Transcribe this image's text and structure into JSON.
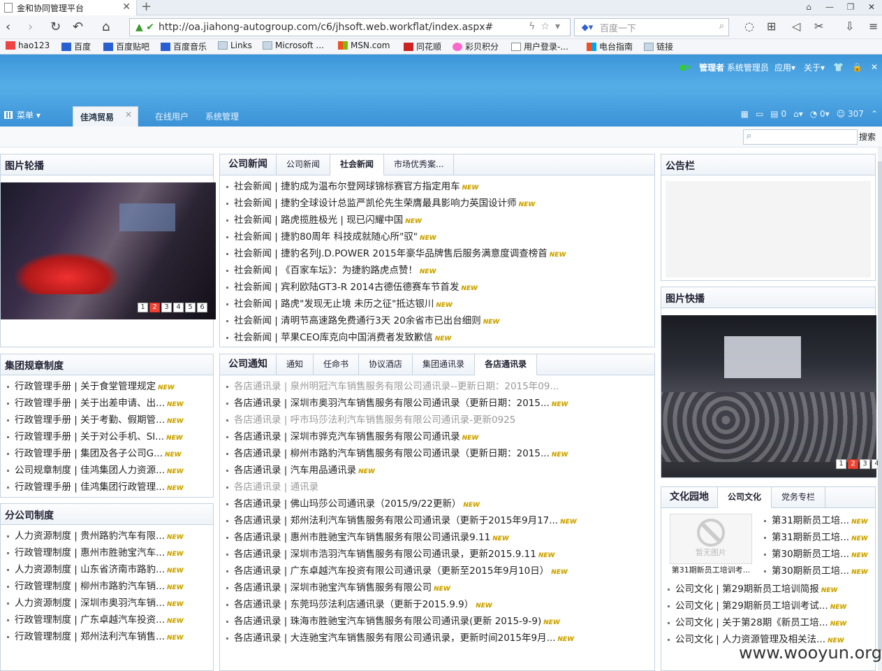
{
  "browser": {
    "tab_title": "金和协同管理平台",
    "url": "http://oa.jiahong-autogroup.com/c6/jhsoft.web.workflat/index.aspx#",
    "search_placeholder": "百度一下",
    "bookmarks": [
      "hao123",
      "百度",
      "百度贴吧",
      "百度音乐",
      "Links",
      "Microsoft ...",
      "MSN.com",
      "同花顺",
      "彩贝积分",
      "用户登录-...",
      "电台指南",
      "链接"
    ]
  },
  "header": {
    "admin_label": "管理者",
    "admin_name": "系统管理员",
    "app_menu": "应用",
    "about_menu": "关于",
    "menu_label": "菜单",
    "active_tab": "佳鸿贸易",
    "tab_online": "在线用户",
    "tab_sys": "系统管理",
    "count_msgs": "0",
    "count_chat": "0",
    "count_users": "307",
    "search_btn": "搜索"
  },
  "badge_new": "NEW",
  "slideshow": {
    "title": "图片轮播",
    "pages": [
      "1",
      "2",
      "3",
      "4",
      "5",
      "6"
    ]
  },
  "news": {
    "title": "公司新闻",
    "tabs": [
      "公司新闻",
      "社会新闻",
      "市场优秀案..."
    ],
    "items": [
      "社会新闻 | 捷豹成为温布尔登网球锦标赛官方指定用车",
      "社会新闻 | 捷豹全球设计总监严凯伦先生荣膺最具影响力英国设计师",
      "社会新闻 | 路虎揽胜极光 | 现已闪耀中国",
      "社会新闻 | 捷豹80周年 科技成就随心所\"驭\"",
      "社会新闻 | 捷豹名列J.D.POWER 2015年豪华品牌售后服务满意度调查榜首",
      "社会新闻 | 《百家车坛》：为捷豹路虎点赞！",
      "社会新闻 | 宾利欧陆GT3-R 2014古德伍德赛车节首发",
      "社会新闻 | 路虎\"发现无止境 未历之征\"抵达银川",
      "社会新闻 | 清明节高速路免费通行3天 20余省市已出台细则",
      "社会新闻 | 苹果CEO库克向中国消费者发致歉信"
    ]
  },
  "notice": {
    "title": "公告栏"
  },
  "quickpics": {
    "title": "图片快播",
    "pages": [
      "1",
      "2",
      "3",
      "4"
    ]
  },
  "rules": {
    "title": "集团规章制度",
    "items": [
      "行政管理手册 | 关于食堂管理规定",
      "行政管理手册 | 关于出差申请、出...",
      "行政管理手册 | 关于考勤、假期管...",
      "行政管理手册 | 关于对公手机、SI...",
      "行政管理手册 | 集团及各子公司G...",
      "公司规章制度 | 佳鸿集团人力资源...",
      "行政管理手册 | 佳鸿集团行政管理..."
    ]
  },
  "branch": {
    "title": "分公司制度",
    "items": [
      "人力资源制度 | 贵州路豹汽车有限...",
      "行政管理制度 | 惠州市胜驰宝汽车...",
      "人力资源制度 | 山东省济南市路豹...",
      "行政管理制度 | 柳州市路豹汽车销...",
      "人力资源制度 | 深圳市奥羽汽车销...",
      "行政管理制度 | 广东卓越汽车投资...",
      "行政管理制度 | 郑州法利汽车销售..."
    ]
  },
  "cnotice": {
    "title": "公司通知",
    "tabs": [
      "通知",
      "任命书",
      "协议酒店",
      "集团通讯录",
      "各店通讯录"
    ],
    "items": [
      {
        "t": "各店通讯录 | 泉州明冠汽车销售服务有限公司通讯录--更新日期：2015年09...",
        "g": true,
        "n": false
      },
      {
        "t": "各店通讯录 | 深圳市奥羽汽车销售服务有限公司通讯录（更新日期：2015...",
        "g": false,
        "n": true
      },
      {
        "t": "各店通讯录 | 呼市玛莎法利汽车销售服务有限公司通讯录-更新0925",
        "g": true,
        "n": false
      },
      {
        "t": "各店通讯录 | 深圳市骅克汽车销售服务有限公司通讯录",
        "g": false,
        "n": true
      },
      {
        "t": "各店通讯录 | 柳州市路豹汽车销售服务有限公司通讯录（更新日期：2015...",
        "g": false,
        "n": true
      },
      {
        "t": "各店通讯录 | 汽车用品通讯录",
        "g": false,
        "n": true
      },
      {
        "t": "各店通讯录 | 通讯录",
        "g": true,
        "n": false
      },
      {
        "t": "各店通讯录 | 佛山玛莎公司通讯录（2015/9/22更新）",
        "g": false,
        "n": true
      },
      {
        "t": "各店通讯录 | 郑州法利汽车销售服务有限公司通讯录（更新于2015年9月17...",
        "g": false,
        "n": true
      },
      {
        "t": "各店通讯录 | 惠州市胜驰宝汽车销售服务有限公司通讯录9.11",
        "g": false,
        "n": true
      },
      {
        "t": "各店通讯录 | 深圳市浩羽汽车销售服务有限公司通讯录，更新2015.9.11",
        "g": false,
        "n": true
      },
      {
        "t": "各店通讯录 | 广东卓越汽车投资有限公司通讯录（更新至2015年9月10日）",
        "g": false,
        "n": true
      },
      {
        "t": "各店通讯录 | 深圳市驰宝汽车销售服务有限公司",
        "g": false,
        "n": true
      },
      {
        "t": "各店通讯录 | 东莞玛莎法利店通讯录（更新于2015.9.9）",
        "g": false,
        "n": true
      },
      {
        "t": "各店通讯录 | 珠海市胜驰宝汽车销售服务有限公司通讯录(更新 2015-9-9)",
        "g": false,
        "n": true
      },
      {
        "t": "各店通讯录 | 大连驰宝汽车销售服务有限公司通讯录，更新时间2015年9月...",
        "g": false,
        "n": true
      }
    ]
  },
  "culture": {
    "title": "文化园地",
    "tabs": [
      "公司文化",
      "党务专栏"
    ],
    "no_pic": "暂无图片",
    "pic_caption": "第31期新员工培训考...",
    "side_items": [
      "第31期新员工培...",
      "第31期新员工培...",
      "第30期新员工培...",
      "第30期新员工培..."
    ],
    "items": [
      "公司文化 | 第29期新员工培训简报",
      "公司文化 | 第29期新员工培训考试...",
      "公司文化 | 关于第28期《新员工培...",
      "公司文化 | 人力资源管理及相关法..."
    ]
  },
  "watermark": "www.wooyun.org"
}
